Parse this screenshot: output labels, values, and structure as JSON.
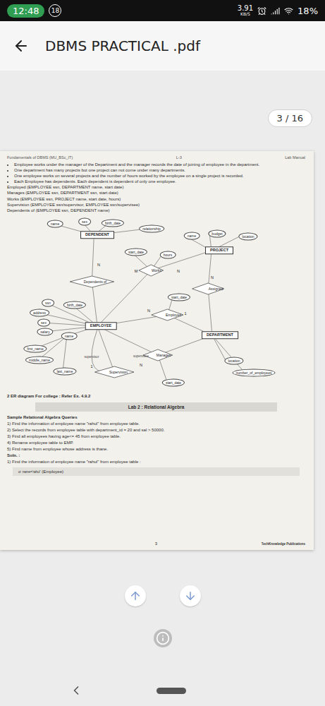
{
  "status_bar": {
    "time": "12:48",
    "notification_count": "18",
    "speed": "3.91",
    "speed_unit": "KB/S",
    "battery": "18%"
  },
  "app_bar": {
    "title": "DBMS PRACTICAL .pdf"
  },
  "page_counter": "3 / 16",
  "document": {
    "header_left": "Fundamentals of DBMS (MU_BSc_IT)",
    "header_center": "L-3",
    "header_right": "Lab Manual",
    "bullets": [
      "Employee works under the manager of the Department and the manager records the date of joining of employee in the department.",
      "One department has many projects but one project can not come under many departments.",
      "One employee works on several projects and the number of hours worked by the employee on a single project is recorded.",
      "Each Employee has dependents. Each dependent is dependent of only one employee."
    ],
    "relations": [
      "Employed (EMPLOYEE ssn, DEPARTMENT name, start date)",
      "Manages (EMPLOYEE ssn, DEPARTMENT ssn, start date)",
      "Works (EMPLOYEE ssn, PROJECT name, start date, hours)",
      "Supervision (EMPLOYEE ssn/supervisor, EMPLOYEE ssn/supervisee)",
      "Dependents of (EMPLOYEE ssn, DEPENDENT name)"
    ],
    "diagram": {
      "entities": [
        "DEPENDENT",
        "PROJECT",
        "EMPLOYEE",
        "DEPARTMENT"
      ],
      "relationships": [
        "Dependents of",
        "Works",
        "Employed",
        "Assigned",
        "Manages",
        "Supervision"
      ],
      "attributes": [
        "name",
        "sex",
        "birth_date",
        "relationship",
        "start_date",
        "hours",
        "name",
        "budget",
        "location",
        "ssn",
        "birth_date",
        "address",
        "sex",
        "salary",
        "name",
        "first_name",
        "middle_name",
        "last_name",
        "start_date",
        "location",
        "number_of_employees",
        "start_date"
      ],
      "cardinalities": [
        "N",
        "M",
        "N",
        "N",
        "N",
        "1",
        "1",
        "N"
      ],
      "roles": [
        "supervisor",
        "supervisee"
      ]
    },
    "er_note": "2 ER diagram For college : Refer Ex. 4.9.2",
    "lab_title": "Lab 2 : Relational Algebra",
    "queries_title": "Sample Relational Algebra Queries",
    "queries": [
      "1) Find the information of employee name \"rahul\" from employee table.",
      "2) Select the records from employee table with department_id = 20 and sal > 50000.",
      "3) Find all employees having age<= 45 from employee table.",
      "4) Rename employee table to EMP.",
      "5) Find name from employee whose address is thane."
    ],
    "solution_label": "Soln. :",
    "solution_query": "1) Find the information of employee name \"rahul\" from employee table :",
    "formula": {
      "sigma": "σ",
      "condition": "name='rahul'",
      "relation": "(Employee)"
    },
    "page_number": "3",
    "publisher": "TechKnowledge Publications"
  }
}
